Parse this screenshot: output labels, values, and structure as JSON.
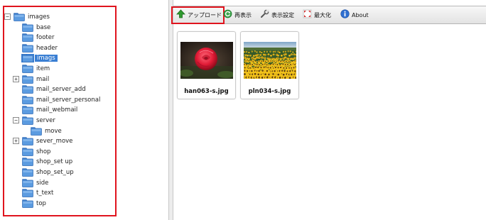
{
  "tree": {
    "nodes": [
      {
        "label": "images",
        "expander": "−",
        "selected": false
      },
      {
        "label": "base",
        "expander": "",
        "selected": false
      },
      {
        "label": "footer",
        "expander": "",
        "selected": false
      },
      {
        "label": "header",
        "expander": "",
        "selected": false
      },
      {
        "label": "imags",
        "expander": "",
        "selected": true
      },
      {
        "label": "item",
        "expander": "",
        "selected": false
      },
      {
        "label": "mail",
        "expander": "+",
        "selected": false
      },
      {
        "label": "mail_server_add",
        "expander": "",
        "selected": false
      },
      {
        "label": "mail_server_personal",
        "expander": "",
        "selected": false
      },
      {
        "label": "mail_webmail",
        "expander": "",
        "selected": false
      },
      {
        "label": "server",
        "expander": "−",
        "selected": false
      },
      {
        "label": "move",
        "expander": "",
        "selected": false
      },
      {
        "label": "sever_move",
        "expander": "+",
        "selected": false
      },
      {
        "label": "shop",
        "expander": "",
        "selected": false
      },
      {
        "label": "shop_set up",
        "expander": "",
        "selected": false
      },
      {
        "label": "shop_set_up",
        "expander": "",
        "selected": false
      },
      {
        "label": "side",
        "expander": "",
        "selected": false
      },
      {
        "label": "t_text",
        "expander": "",
        "selected": false
      },
      {
        "label": "top",
        "expander": "",
        "selected": false
      }
    ]
  },
  "toolbar": {
    "upload_label": "アップロード",
    "refresh_label": "再表示",
    "settings_label": "表示設定",
    "maximize_label": "最大化",
    "about_label": "About"
  },
  "files": [
    {
      "name": "han063-s.jpg",
      "icon": "red-rose-photo"
    },
    {
      "name": "pln034-s.jpg",
      "icon": "sunflower-field-photo"
    }
  ],
  "colors": {
    "highlight": "#e0141e",
    "selection": "#3a7fd3",
    "folder": "#5b9be0"
  }
}
